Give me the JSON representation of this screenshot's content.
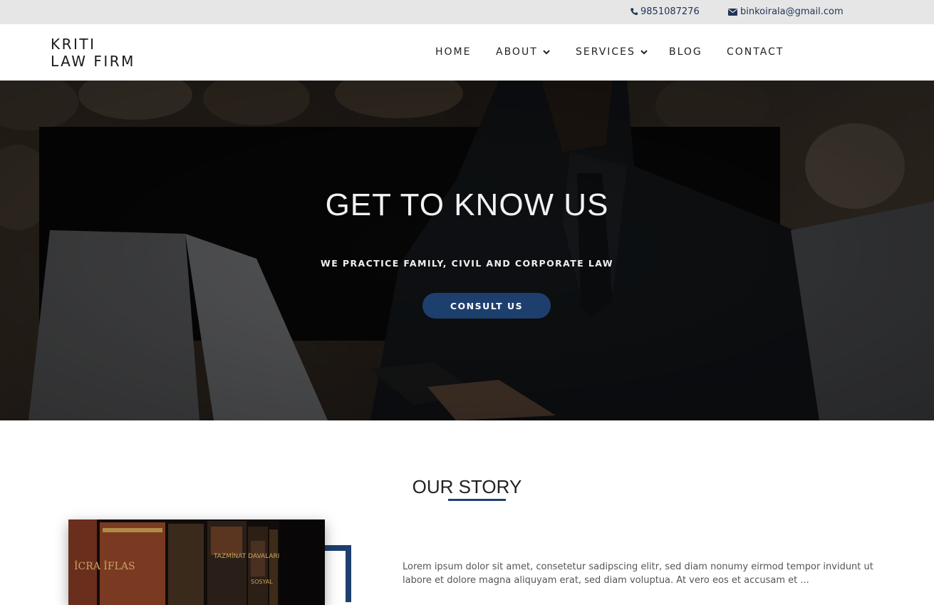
{
  "topbar": {
    "phone_icon": "phone-icon",
    "phone": "9851087276",
    "email_icon": "envelope-icon",
    "email": "binkoirala@gmail.com"
  },
  "brand": {
    "line1": "KRITI",
    "line2": "LAW FIRM"
  },
  "nav": {
    "home": "HOME",
    "about": "ABOUT",
    "services": "SERVICES",
    "blog": "BLOG",
    "contact": "CONTACT",
    "dropdown_icon": "chevron-down-icon"
  },
  "hero": {
    "title": "GET TO KNOW US",
    "subtitle": "WE PRACTICE FAMILY, CIVIL AND CORPORATE LAW",
    "button": "CONSULT US"
  },
  "story": {
    "title": "OUR STORY",
    "text": "Lorem ipsum dolor sit amet, consetetur sadipscing elitr, sed diam nonumy eirmod tempor invidunt ut labore et dolore magna aliquyam erat, sed diam voluptua. At vero eos et accusam et ...",
    "book_labels": [
      "İCRA İFLAS",
      "TAZMİNAT DAVALARI",
      "SOSYAL"
    ]
  },
  "colors": {
    "accent": "#1d3f6e",
    "topbar_bg": "#e6e6e6",
    "link": "#1d3557"
  }
}
